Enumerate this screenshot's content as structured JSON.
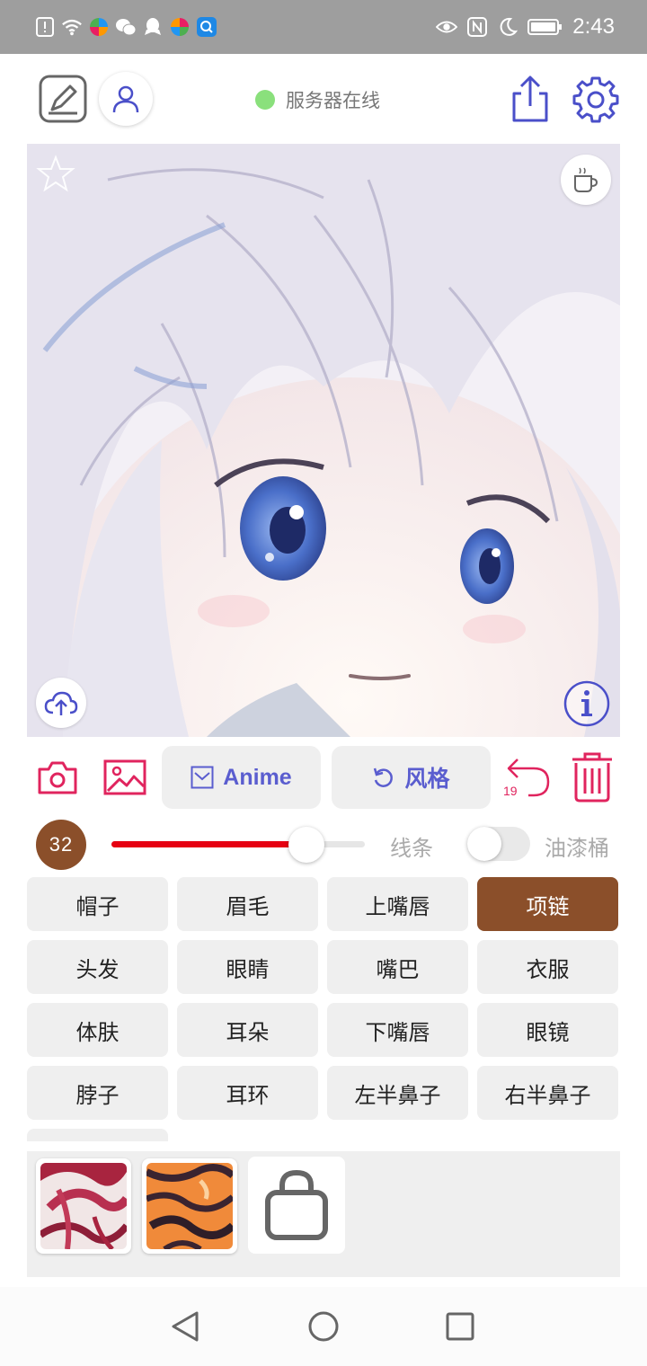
{
  "status_bar": {
    "time": "2:43",
    "left_icons": [
      "alert-icon",
      "wifi-icon",
      "app-colorful-icon",
      "wechat-icon",
      "qq-icon",
      "app-colorful-icon",
      "search-app-icon"
    ],
    "right_icons": [
      "eye-icon",
      "nfc-icon",
      "moon-icon",
      "battery-icon"
    ]
  },
  "toolbar": {
    "server_status": "服务器在线",
    "server_status_color": "#8ae07c",
    "accent_color": "#4a4fc9"
  },
  "action_row": {
    "anime_label": "Anime",
    "style_label": "风格",
    "undo_count": "19",
    "accent_pink": "#e0245e"
  },
  "brush": {
    "size": "32",
    "slider_fraction": 0.77,
    "line_label": "线条",
    "bucket_label": "油漆桶",
    "bucket_enabled": false,
    "badge_color": "#8b4f2a"
  },
  "parts": [
    {
      "label": "帽子",
      "selected": false
    },
    {
      "label": "眉毛",
      "selected": false
    },
    {
      "label": "上嘴唇",
      "selected": false
    },
    {
      "label": "项链",
      "selected": true
    },
    {
      "label": "头发",
      "selected": false
    },
    {
      "label": "眼睛",
      "selected": false
    },
    {
      "label": "嘴巴",
      "selected": false
    },
    {
      "label": "衣服",
      "selected": false
    },
    {
      "label": "体肤",
      "selected": false
    },
    {
      "label": "耳朵",
      "selected": false
    },
    {
      "label": "下嘴唇",
      "selected": false
    },
    {
      "label": "眼镜",
      "selected": false
    },
    {
      "label": "脖子",
      "selected": false
    },
    {
      "label": "耳环",
      "selected": false
    },
    {
      "label": "左半鼻子",
      "selected": false
    },
    {
      "label": "右半鼻子",
      "selected": false
    },
    {
      "label": "",
      "selected": false
    }
  ],
  "palette": {
    "swatches": [
      "red-white-texture",
      "orange-tiger-texture"
    ],
    "shop_icon": "shopping-bag-icon"
  },
  "nav": {
    "icons": [
      "back-icon",
      "home-icon",
      "recents-icon"
    ]
  }
}
